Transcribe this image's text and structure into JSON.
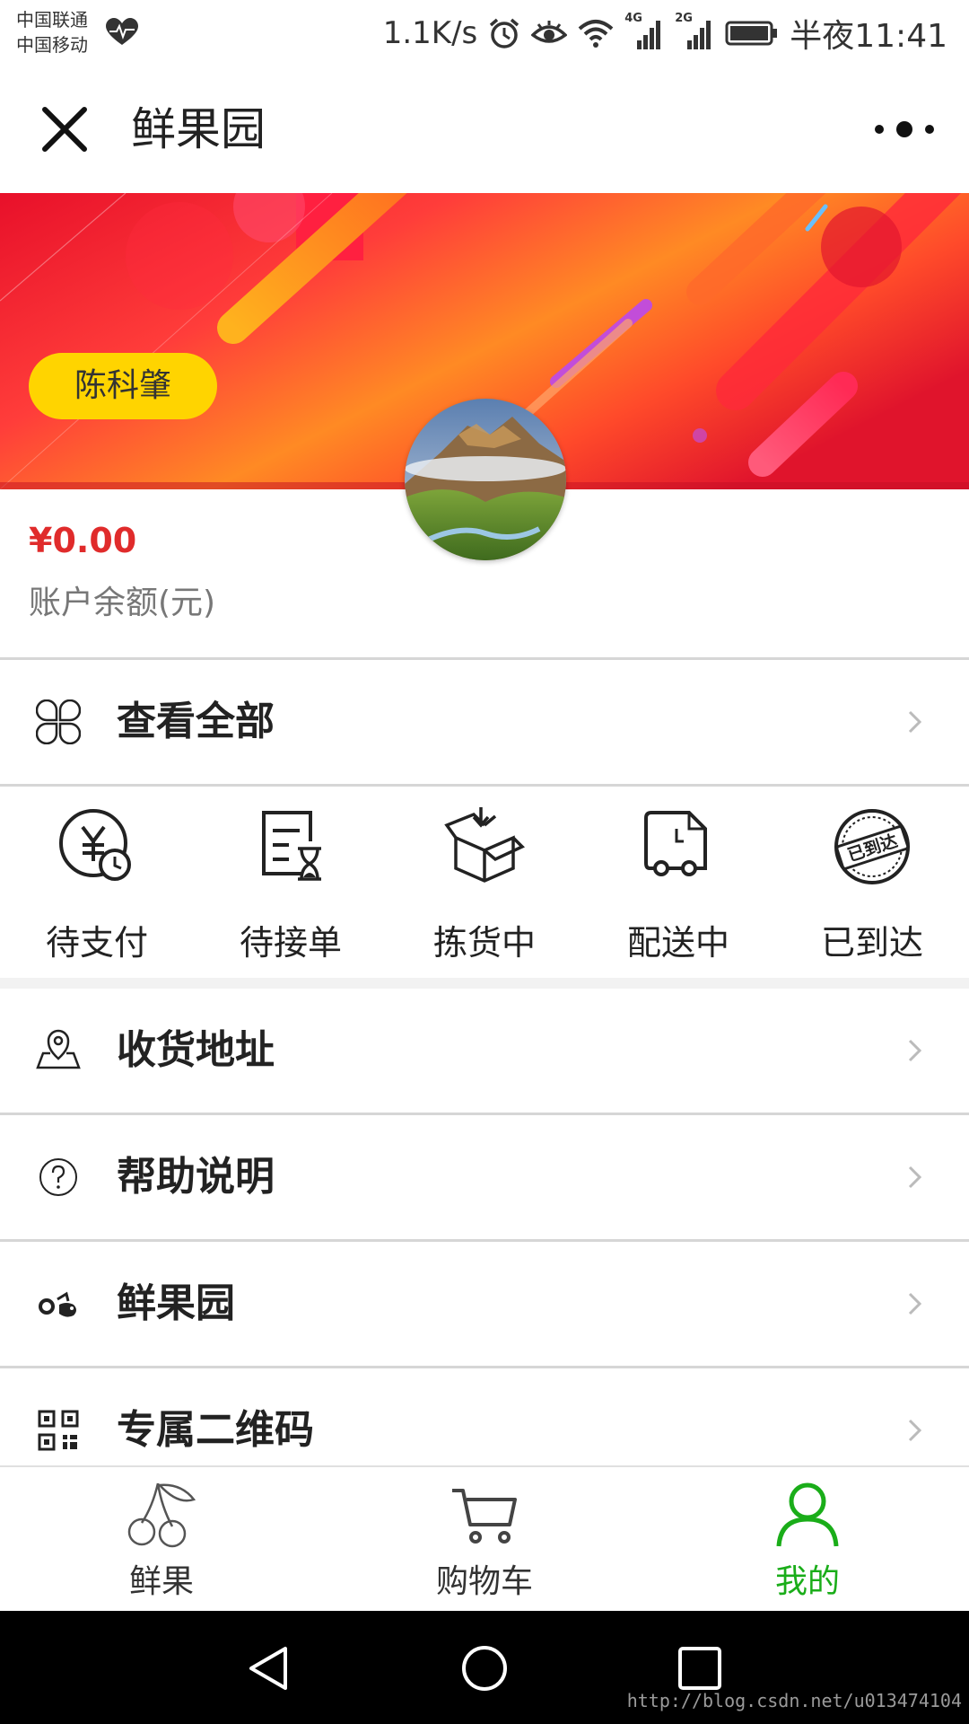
{
  "status_bar": {
    "carrier_1": "中国联通",
    "carrier_2": "中国移动",
    "speed": "1.1K/s",
    "net_1": "4G",
    "net_2": "2G",
    "time": "半夜11:41"
  },
  "header": {
    "title": "鲜果园"
  },
  "profile": {
    "name": "陈科肇",
    "balance_amount": "¥0.00",
    "balance_label": "账户余额(元)"
  },
  "orders_header": {
    "label": "查看全部"
  },
  "order_status": [
    {
      "label": "待支付",
      "icon": "yuan-clock-icon"
    },
    {
      "label": "待接单",
      "icon": "order-hourglass-icon"
    },
    {
      "label": "拣货中",
      "icon": "package-icon"
    },
    {
      "label": "配送中",
      "icon": "delivery-truck-icon"
    },
    {
      "label": "已到达",
      "icon": "arrived-stamp-icon",
      "stamp_text": "已到达"
    }
  ],
  "menu": [
    {
      "label": "收货地址",
      "icon": "location-pin-icon"
    },
    {
      "label": "帮助说明",
      "icon": "question-circle-icon"
    },
    {
      "label": "鲜果园",
      "icon": "fruit-logo-icon"
    },
    {
      "label": "专属二维码",
      "icon": "qr-code-icon"
    }
  ],
  "tabbar": [
    {
      "label": "鲜果",
      "icon": "cherry-icon",
      "active": false
    },
    {
      "label": "购物车",
      "icon": "cart-icon",
      "active": false
    },
    {
      "label": "我的",
      "icon": "user-icon",
      "active": true
    }
  ],
  "colors": {
    "accent_green": "#1aad19",
    "balance_red": "#e02b2b",
    "name_pill": "#ffd400"
  },
  "watermark": "http://blog.csdn.net/u013474104"
}
